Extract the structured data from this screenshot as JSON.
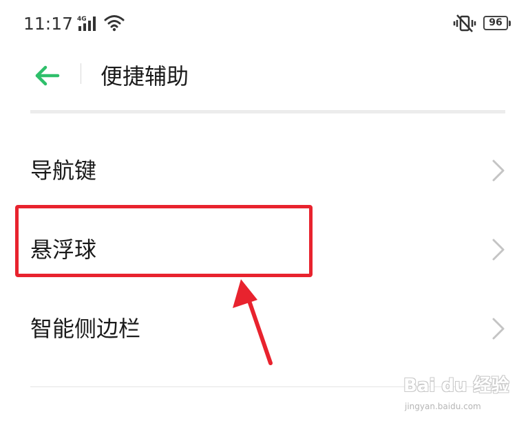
{
  "status_bar": {
    "time": "11:17",
    "network_type": "4G",
    "signal_icon": "cellular-signal-icon",
    "wifi_icon": "wifi-icon",
    "vibrate_icon": "vibrate-mode-icon",
    "battery_level": "96"
  },
  "header": {
    "back_icon": "arrow-left-icon",
    "title": "便捷辅助",
    "accent_color": "#2ebf6a"
  },
  "list": {
    "items": [
      {
        "label": "导航键",
        "chevron_icon": "chevron-right-icon"
      },
      {
        "label": "悬浮球",
        "chevron_icon": "chevron-right-icon"
      },
      {
        "label": "智能侧边栏",
        "chevron_icon": "chevron-right-icon"
      }
    ]
  },
  "annotation": {
    "highlight_color": "#e8232e",
    "highlighted_item": "悬浮球"
  },
  "watermark": {
    "logo_text": "Bai du 经验",
    "url": "jingyan.baidu.com"
  }
}
